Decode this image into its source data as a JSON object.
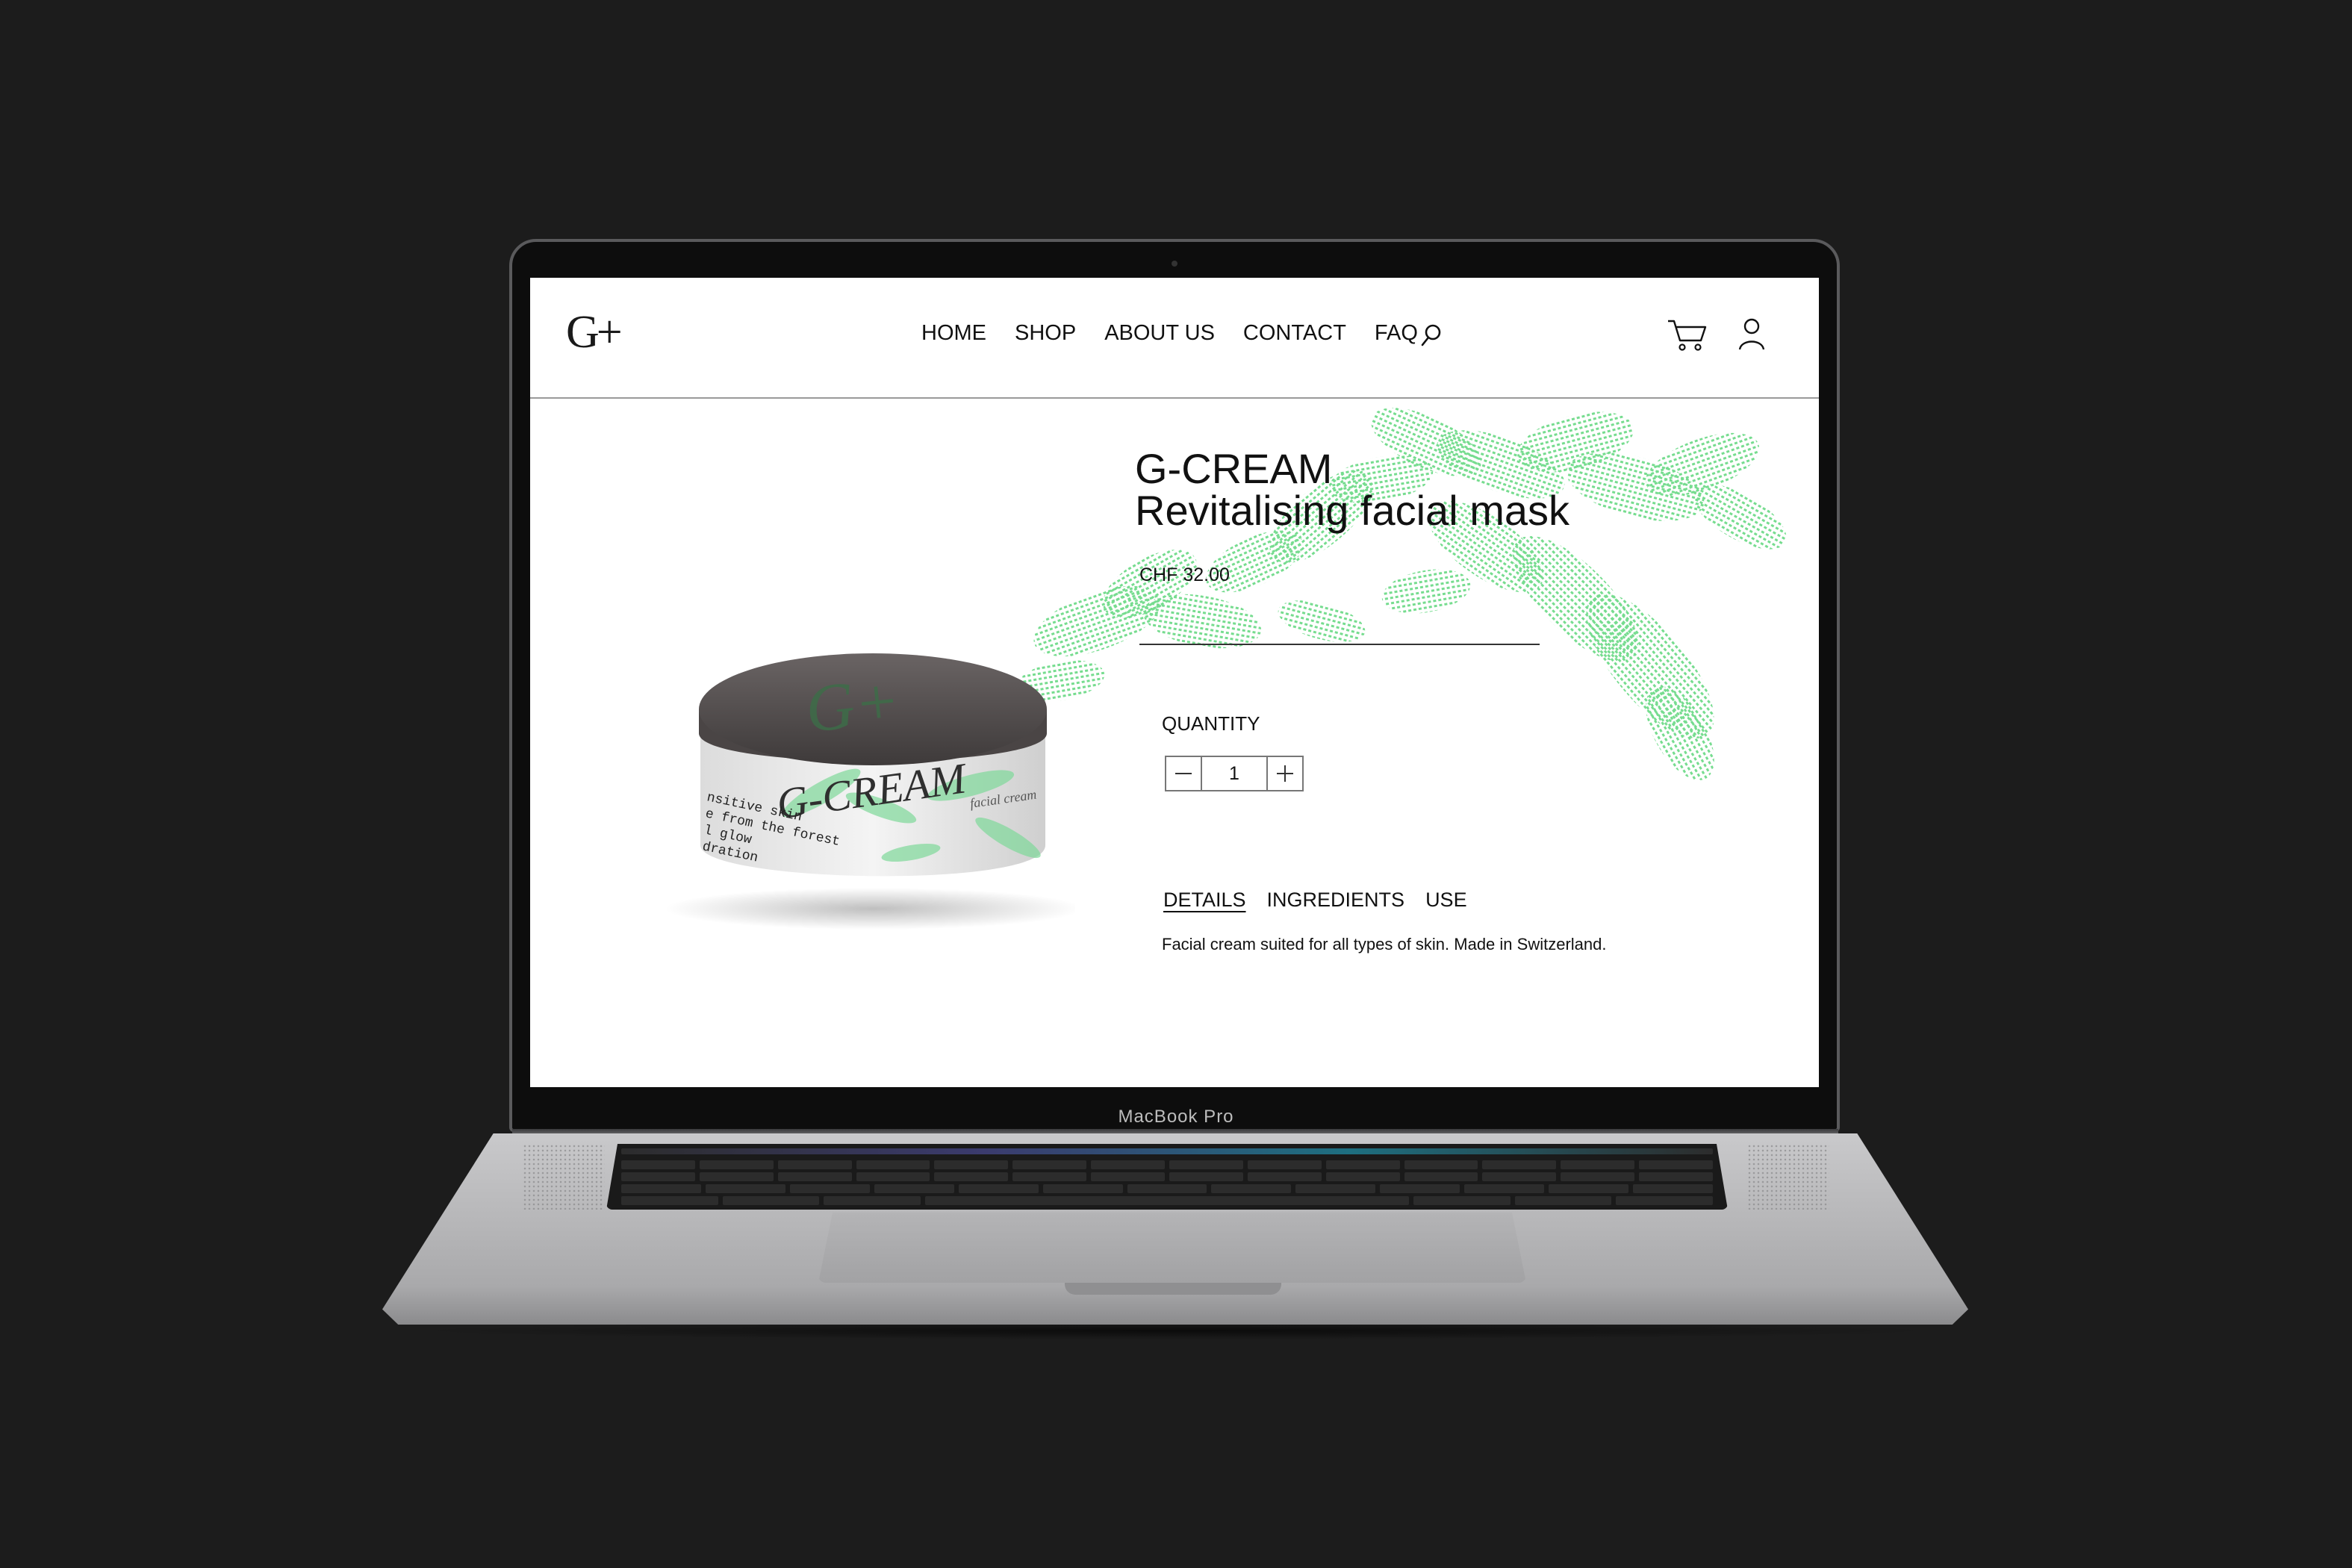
{
  "device": {
    "model_label": "MacBook Pro"
  },
  "site": {
    "logo": "G+",
    "nav": {
      "home": "HOME",
      "shop": "SHOP",
      "about": "ABOUT US",
      "contact": "CONTACT",
      "faq": "FAQ"
    },
    "icons": [
      "search-icon",
      "cart-icon",
      "user-icon"
    ],
    "product": {
      "name_line1": "G-CREAM",
      "name_line2": "Revitalising facial mask",
      "price": "CHF 32.00",
      "quantity_label": "QUANTITY",
      "quantity_value": "1",
      "tabs": {
        "details": "DETAILS",
        "ingredients": "INGREDIENTS",
        "use": "USE"
      },
      "active_tab": "DETAILS",
      "description": "Facial cream suited for all types of skin. Made in Switzerland.",
      "jar_lid_logo": "G+",
      "jar_label_brand": "G-CREAM",
      "jar_label_subtitle": "facial cream",
      "jar_label_lines": [
        "nsitive skin",
        "e from the forest",
        "l glow",
        "dration"
      ]
    },
    "colors": {
      "accent_green": "#5fd77c",
      "text": "#111111",
      "background": "#ffffff"
    }
  }
}
